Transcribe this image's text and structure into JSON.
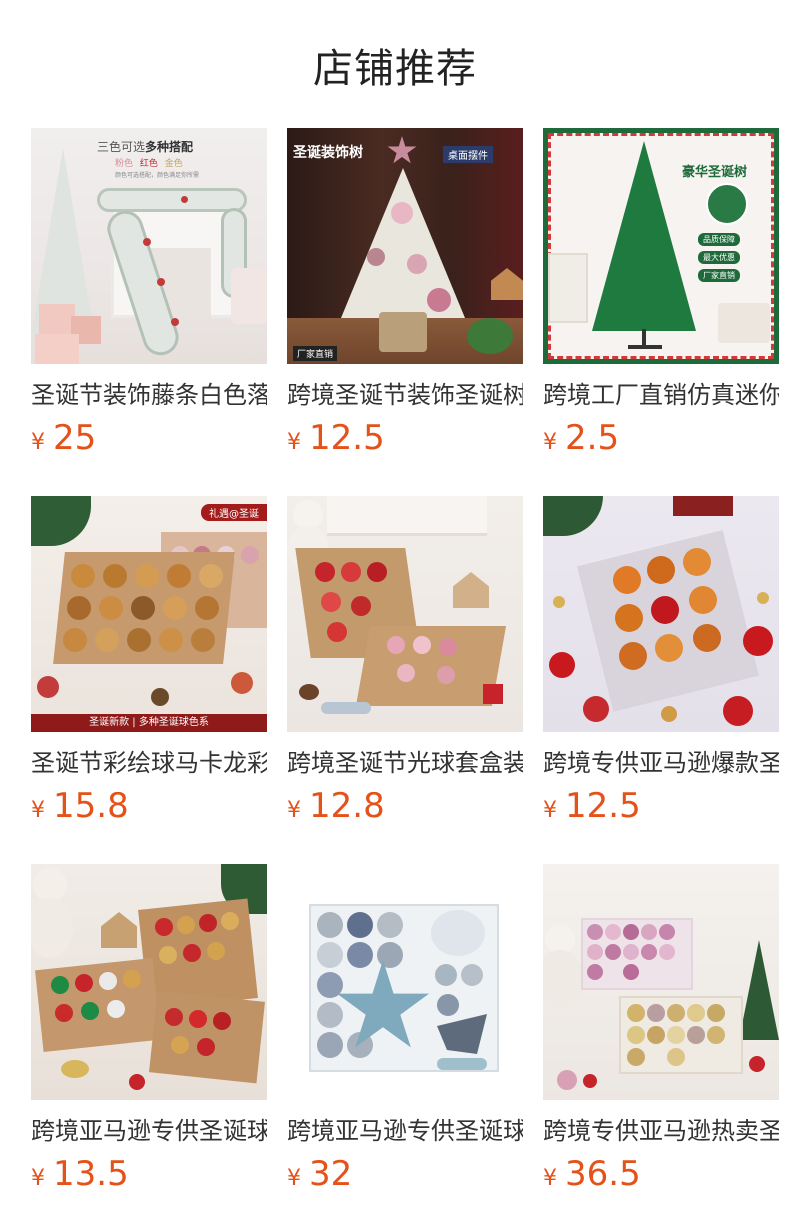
{
  "page": {
    "title": "店铺推荐"
  },
  "products": [
    {
      "title": "圣诞节装饰藤条白色落雪",
      "currency": "¥",
      "price": "25",
      "image_text": {
        "header": "三色可选",
        "header_strong": "多种搭配",
        "colors": [
          "粉色",
          "红色",
          "金色"
        ],
        "sub": "颜色可选搭配，颜色满足你所需"
      },
      "image_icon": "garland-image"
    },
    {
      "title": "跨境圣诞节装饰圣诞树桌面",
      "currency": "¥",
      "price": "12.5",
      "image_text": {
        "left_label": "圣诞装饰树",
        "right_label": "桌面摆件",
        "footer": "厂家直销"
      },
      "image_icon": "mini-tree-image"
    },
    {
      "title": "跨境工厂直销仿真迷你圣诞",
      "currency": "¥",
      "price": "2.5",
      "image_text": {
        "headline": "豪华圣诞树",
        "badges": [
          "品质保障",
          "最大优惠",
          "厂家直销"
        ]
      },
      "image_icon": "green-tree-image"
    },
    {
      "title": "圣诞节彩绘球马卡龙彩色球",
      "currency": "¥",
      "price": "15.8",
      "image_text": {
        "corner": "礼遇@圣诞",
        "footer": "圣诞新款 | 多种圣诞球色系"
      },
      "image_icon": "gold-ball-box-image"
    },
    {
      "title": "跨境圣诞节光球套盒装饰品",
      "currency": "¥",
      "price": "12.8",
      "image_icon": "red-pink-ball-box-image"
    },
    {
      "title": "跨境专供亚马逊爆款圣诞球",
      "currency": "¥",
      "price": "12.5",
      "image_icon": "orange-red-ball-box-image"
    },
    {
      "title": "跨境亚马逊专供圣诞球礼盒",
      "currency": "¥",
      "price": "13.5",
      "image_icon": "red-gold-ball-boxes-image"
    },
    {
      "title": "跨境亚马逊专供圣诞球套装",
      "currency": "¥",
      "price": "32",
      "image_icon": "blue-silver-ball-box-image"
    },
    {
      "title": "跨境专供亚马逊热卖圣诞球",
      "currency": "¥",
      "price": "36.5",
      "image_icon": "pink-gold-ball-boxes-image"
    }
  ],
  "colors": {
    "price": "#e4521a",
    "title": "#333333",
    "heading": "#222222"
  }
}
